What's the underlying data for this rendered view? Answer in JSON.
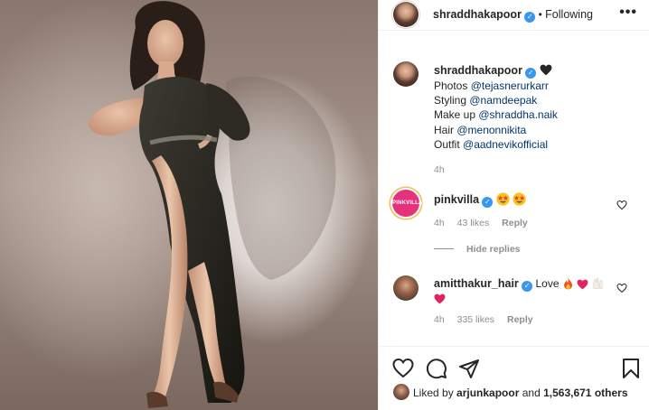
{
  "post": {
    "author": "shraddhakapoor",
    "follow_status": "Following",
    "separator": "•",
    "more_label": "•••"
  },
  "caption": {
    "author": "shraddhakapoor",
    "lines": [
      {
        "label": "Photos ",
        "mention": "@tejasnerurkarr"
      },
      {
        "label": "Styling ",
        "mention": "@namdeepak"
      },
      {
        "label": "Make up ",
        "mention": "@shraddha.naik"
      },
      {
        "label": "Hair ",
        "mention": "@menonnikita"
      },
      {
        "label": "Outfit ",
        "mention": "@aadnevikofficial"
      }
    ],
    "time": "4h"
  },
  "comments": [
    {
      "author": "pinkvilla",
      "logo_text": "PINKVILLA",
      "text": "",
      "emojis": [
        "star-struck",
        "star-struck"
      ],
      "time": "4h",
      "likes": "43 likes",
      "reply": "Reply"
    },
    {
      "author": "amitthakur_hair",
      "text": "Love",
      "emojis": [
        "fire",
        "red-heart",
        "raised-hands",
        "red-heart"
      ],
      "time": "4h",
      "likes": "335 likes",
      "reply": "Reply"
    }
  ],
  "hide_replies": "Hide replies",
  "likes_summary": {
    "prefix": "Liked by ",
    "user": "arjunkapoor",
    "middle": " and ",
    "count": "1,563,671 others"
  },
  "colors": {
    "mention": "#00376b",
    "verified": "#3897f0",
    "muted": "#8e8e8e",
    "pinkvilla": "#e6317d"
  }
}
